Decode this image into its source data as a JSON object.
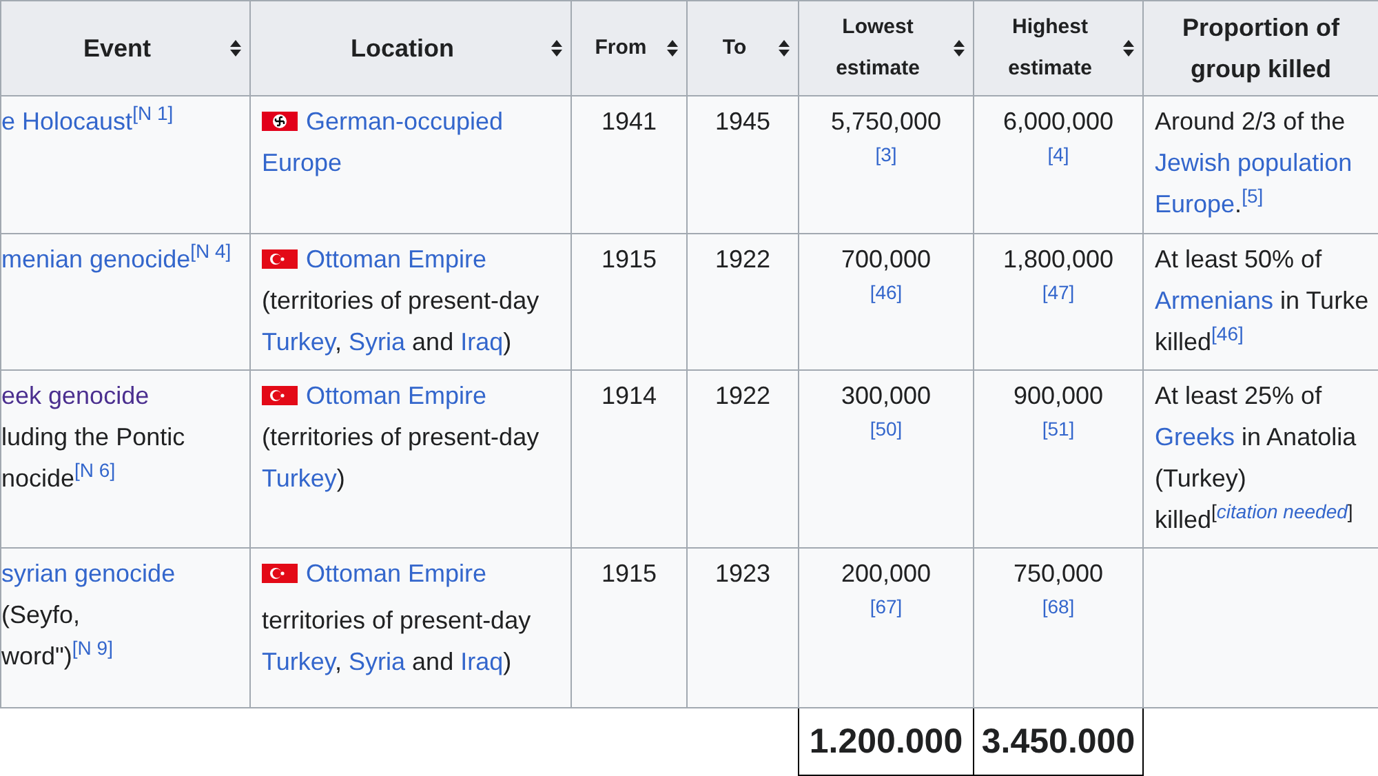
{
  "table": {
    "columns": [
      {
        "label": "Event",
        "sortable": true
      },
      {
        "label": "Location",
        "sortable": true
      },
      {
        "label": "From",
        "sortable": true
      },
      {
        "label": "To",
        "sortable": true
      },
      {
        "label": "Lowest estimate",
        "sortable": true
      },
      {
        "label": "Highest estimate",
        "sortable": true
      },
      {
        "label": "Proportion of group killed",
        "sortable": false
      }
    ],
    "rows": [
      {
        "event": [
          [
            {
              "t": "e Holocaust",
              "kind": "link"
            },
            {
              "t": "[N 1]",
              "kind": "note"
            }
          ]
        ],
        "location": {
          "kind": "swastika",
          "lines": [
            [
              {
                "t": "German-occupied",
                "kind": "link"
              }
            ],
            [
              {
                "t": "Europe",
                "kind": "link"
              }
            ]
          ]
        },
        "from": "1941",
        "to": "1945",
        "lowest": {
          "value": "5,750,000",
          "ref": "[3]"
        },
        "highest": {
          "value": "6,000,000",
          "ref": "[4]"
        },
        "proportion": [
          [
            {
              "t": "Around 2/3 of the",
              "kind": "text"
            }
          ],
          [
            {
              "t": "Jewish population",
              "kind": "link"
            }
          ],
          [
            {
              "t": "Europe",
              "kind": "link"
            },
            {
              "t": ".",
              "kind": "text"
            },
            {
              "t": "[5]",
              "kind": "note"
            }
          ]
        ]
      },
      {
        "event": [
          [
            {
              "t": "menian genocide",
              "kind": "link"
            },
            {
              "t": "[N 4]",
              "kind": "note"
            }
          ]
        ],
        "location": {
          "kind": "crescent",
          "lines": [
            [
              {
                "t": "Ottoman Empire",
                "kind": "link"
              }
            ],
            [
              {
                "t": "(territories of present-day",
                "kind": "text"
              }
            ],
            [
              {
                "t": "Turkey",
                "kind": "link"
              },
              {
                "t": ", ",
                "kind": "text"
              },
              {
                "t": "Syria",
                "kind": "link"
              },
              {
                "t": " and ",
                "kind": "text"
              },
              {
                "t": "Iraq",
                "kind": "link"
              },
              {
                "t": ")",
                "kind": "text"
              }
            ]
          ]
        },
        "from": "1915",
        "to": "1922",
        "lowest": {
          "value": "700,000",
          "ref": "[46]"
        },
        "highest": {
          "value": "1,800,000",
          "ref": "[47]"
        },
        "proportion": [
          [
            {
              "t": "At least 50% of",
              "kind": "text"
            }
          ],
          [
            {
              "t": "Armenians",
              "kind": "link"
            },
            {
              "t": " in Turke",
              "kind": "text"
            }
          ],
          [
            {
              "t": "killed",
              "kind": "text"
            },
            {
              "t": "[46]",
              "kind": "note"
            }
          ]
        ]
      },
      {
        "event": [
          [
            {
              "t": "eek genocide",
              "kind": "visited"
            }
          ],
          [
            {
              "t": "luding the Pontic",
              "kind": "text"
            }
          ],
          [
            {
              "t": "nocide",
              "kind": "text"
            },
            {
              "t": "[N 6]",
              "kind": "note"
            }
          ]
        ],
        "location": {
          "kind": "crescent",
          "lines": [
            [
              {
                "t": "Ottoman Empire",
                "kind": "link"
              }
            ],
            [
              {
                "t": "(territories of present-day",
                "kind": "text"
              }
            ],
            [
              {
                "t": "Turkey",
                "kind": "link"
              },
              {
                "t": ")",
                "kind": "text"
              }
            ]
          ]
        },
        "from": "1914",
        "to": "1922",
        "lowest": {
          "value": "300,000",
          "ref": "[50]"
        },
        "highest": {
          "value": "900,000",
          "ref": "[51]"
        },
        "proportion": [
          [
            {
              "t": "At least 25% of",
              "kind": "text"
            }
          ],
          [
            {
              "t": "Greeks",
              "kind": "link"
            },
            {
              "t": " in Anatolia",
              "kind": "text"
            }
          ],
          [
            {
              "t": "(Turkey)",
              "kind": "text"
            }
          ],
          [
            {
              "t": "killed",
              "kind": "text"
            },
            {
              "t": "[",
              "kind": "bracket"
            },
            {
              "t": "citation needed",
              "kind": "tag"
            },
            {
              "t": "]",
              "kind": "bracket"
            }
          ]
        ]
      },
      {
        "event": [
          [
            {
              "t": "syrian genocide",
              "kind": "link"
            }
          ],
          [
            {
              "t": "(Seyfo,",
              "kind": "text"
            }
          ],
          [
            {
              "t": "word\")",
              "kind": "text"
            },
            {
              "t": "[N 9]",
              "kind": "note"
            }
          ]
        ],
        "location": {
          "kind": "crescent",
          "lines": [
            [
              {
                "t": "Ottoman Empire",
                "kind": "link"
              }
            ],
            [
              {
                "t": "territories of present-day",
                "kind": "text"
              }
            ],
            [
              {
                "t": "Turkey",
                "kind": "link"
              },
              {
                "t": ", ",
                "kind": "text"
              },
              {
                "t": "Syria",
                "kind": "link"
              },
              {
                "t": " and ",
                "kind": "text"
              },
              {
                "t": "Iraq",
                "kind": "link"
              },
              {
                "t": ")",
                "kind": "text"
              }
            ]
          ]
        },
        "from": "1915",
        "to": "1923",
        "lowest": {
          "value": "200,000",
          "ref": "[67]"
        },
        "highest": {
          "value": "750,000",
          "ref": "[68]"
        }
      }
    ],
    "totals": {
      "lowest": "1.200.000",
      "highest": "3.450.000"
    }
  }
}
